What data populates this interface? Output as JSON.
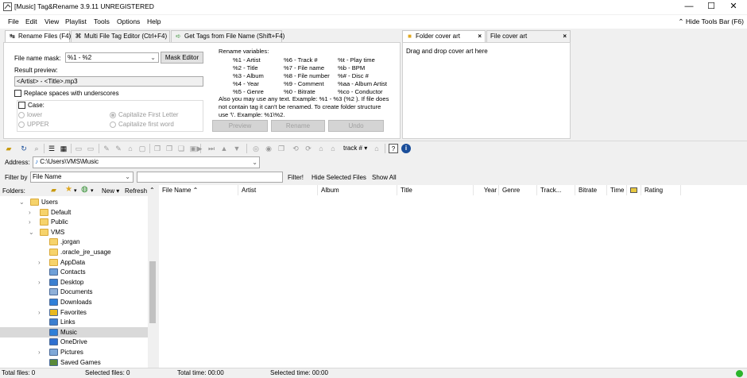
{
  "window": {
    "title": "[Music] Tag&Rename 3.9.11 UNREGISTERED",
    "minimize": "—",
    "maximize": "☐",
    "close": "✕"
  },
  "menu": [
    "File",
    "Edit",
    "View",
    "Playlist",
    "Tools",
    "Options",
    "Help"
  ],
  "hide_tools_bar": "Hide Tools Bar (F6)",
  "tabs": [
    {
      "label": "Rename Files (F4)",
      "icon": "rename-arrow-icon"
    },
    {
      "label": "Multi File Tag Editor (Ctrl+F4)",
      "icon": "multi-tag-icon"
    },
    {
      "label": "Get Tags from File Name (Shift+F4)",
      "icon": "get-tags-icon"
    }
  ],
  "cover_tabs": [
    {
      "label": "Folder cover art",
      "icon": "folder-icon",
      "close": "×"
    },
    {
      "label": "File cover art",
      "close": "×"
    }
  ],
  "cover_hint": "Drag and drop cover art here",
  "rename": {
    "mask_label": "File name mask:",
    "mask_value": "%1 - %2",
    "mask_editor": "Mask Editor",
    "preview_label": "Result preview:",
    "preview_value": "<Artist> - <Title>.mp3",
    "replace_spaces": "Replace spaces with underscores",
    "case_label": "Case:",
    "case_options": [
      "lower",
      "UPPER",
      "Capitalize First Letter",
      "Capitalize first word"
    ],
    "vars_title": "Rename variables:",
    "vars_col1": [
      "%1 - Artist",
      "%2 - Title",
      "%3 - Album",
      "%4 - Year",
      "%5 - Genre"
    ],
    "vars_col2": [
      "%6 - Track #",
      "%7 - File name",
      "%8 - File number",
      "%9 - Comment",
      "%0 - Bitrate"
    ],
    "vars_col3": [
      "%t - Play time",
      "%b - BPM",
      "%# - Disc #",
      "%aa - Album Artist",
      "%co - Conductor"
    ],
    "vars_note": [
      "Also you may use any text. Example: %1 - %3 (%2 ). If file does",
      "not contain tag it can't be renamed. To create folder structure",
      "use '\\'. Example: %1\\%2."
    ],
    "btn_preview": "Preview",
    "btn_rename": "Rename",
    "btn_undo": "Undo"
  },
  "toolbar": {
    "track_dropdown": "track #",
    "icons": [
      "open-folder-icon",
      "refresh-icon",
      "search-icon",
      "playlist-icon",
      "grid-icon"
    ]
  },
  "address": {
    "label": "Address:",
    "value": "C:\\Users\\VMS\\Music"
  },
  "filter": {
    "label": "Filter by",
    "field": "File Name",
    "value": "",
    "apply": "Filter!",
    "hide_selected": "Hide Selected Files",
    "show_all": "Show All"
  },
  "folders": {
    "label": "Folders:",
    "new": "New",
    "refresh": "Refresh"
  },
  "tree": [
    {
      "label": "Users",
      "indent": 0,
      "arrow": "⌄",
      "icon": "folder"
    },
    {
      "label": "Default",
      "indent": 1,
      "arrow": "›",
      "icon": "folder"
    },
    {
      "label": "Public",
      "indent": 1,
      "arrow": "›",
      "icon": "folder"
    },
    {
      "label": "VMS",
      "indent": 1,
      "arrow": "⌄",
      "icon": "folder"
    },
    {
      "label": ".jorgan",
      "indent": 2,
      "arrow": "",
      "icon": "folder"
    },
    {
      "label": ".oracle_jre_usage",
      "indent": 2,
      "arrow": "",
      "icon": "folder"
    },
    {
      "label": "AppData",
      "indent": 2,
      "arrow": "›",
      "icon": "folder"
    },
    {
      "label": "Contacts",
      "indent": 2,
      "arrow": "",
      "icon": "contacts"
    },
    {
      "label": "Desktop",
      "indent": 2,
      "arrow": "›",
      "icon": "desktop"
    },
    {
      "label": "Documents",
      "indent": 2,
      "arrow": "",
      "icon": "documents"
    },
    {
      "label": "Downloads",
      "indent": 2,
      "arrow": "",
      "icon": "downloads"
    },
    {
      "label": "Favorites",
      "indent": 2,
      "arrow": "›",
      "icon": "favorites"
    },
    {
      "label": "Links",
      "indent": 2,
      "arrow": "",
      "icon": "links"
    },
    {
      "label": "Music",
      "indent": 2,
      "arrow": "",
      "icon": "music",
      "selected": true
    },
    {
      "label": "OneDrive",
      "indent": 2,
      "arrow": "",
      "icon": "onedrive"
    },
    {
      "label": "Pictures",
      "indent": 2,
      "arrow": "›",
      "icon": "pictures"
    },
    {
      "label": "Saved Games",
      "indent": 2,
      "arrow": "",
      "icon": "games"
    }
  ],
  "columns": [
    "File Name",
    "Artist",
    "Album",
    "Title",
    "Year",
    "Genre",
    "Track...",
    "Bitrate",
    "Time",
    "",
    "Rating"
  ],
  "status": {
    "total_files": "Total files: 0",
    "selected_files": "Selected files: 0",
    "total_time": "Total time: 00:00",
    "selected_time": "Selected time: 00:00"
  }
}
